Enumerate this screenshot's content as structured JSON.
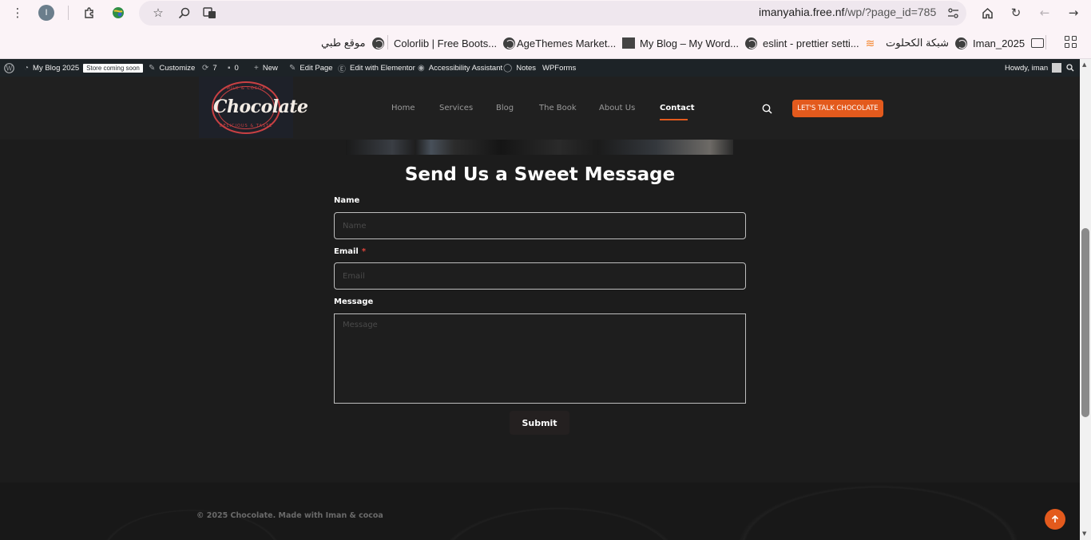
{
  "browser": {
    "url_host": "imanyahia.free.nf",
    "url_path": "/wp/?page_id=785",
    "profile_initial": "I",
    "bookmarks": [
      {
        "label": "موقع طبي",
        "icon": "globe-icon"
      },
      {
        "label": "Colorlib | Free Boots...",
        "icon": "globe-icon"
      },
      {
        "label": "AgeThemes Market...",
        "icon": "agethemes-icon"
      },
      {
        "label": "My Blog – My Word...",
        "icon": "globe-icon"
      },
      {
        "label": "eslint - prettier setti...",
        "icon": "stackoverflow-icon"
      },
      {
        "label": "شبكة الكحلوت",
        "icon": "globe-icon"
      },
      {
        "label": "Iman_2025",
        "icon": "folder-icon"
      }
    ]
  },
  "adminbar": {
    "site_name": "My Blog 2025",
    "store_badge": "Store coming soon",
    "customize": "Customize",
    "updates_count": "7",
    "comments_count": "0",
    "new": "New",
    "edit_page": "Edit Page",
    "edit_elementor": "Edit with Elementor",
    "accessibility": "Accessibility Assistant",
    "notes": "Notes",
    "wpforms": "WPForms",
    "howdy": "Howdy, iman"
  },
  "header": {
    "logo_text": "Chocolate",
    "logo_top": "MILK & COCOA",
    "logo_bottom": "DELICIOUS & TASTE",
    "nav": [
      "Home",
      "Services",
      "Blog",
      "The Book",
      "About Us",
      "Contact"
    ],
    "cta": "LET'S TALK CHOCOLATE"
  },
  "form": {
    "title": "Send Us a Sweet Message",
    "name_label": "Name",
    "name_placeholder": "Name",
    "email_label": "Email",
    "email_required": "*",
    "email_placeholder": "Email",
    "message_label": "Message",
    "message_placeholder": "Message",
    "submit": "Submit"
  },
  "footer": {
    "copyright": "© 2025 Chocolate. Made with Iman & cocoa"
  },
  "colors": {
    "accent": "#e35a1d",
    "page_bg": "#1c1c1c",
    "header_bg": "#202020",
    "adminbar_bg": "#1d2327"
  }
}
